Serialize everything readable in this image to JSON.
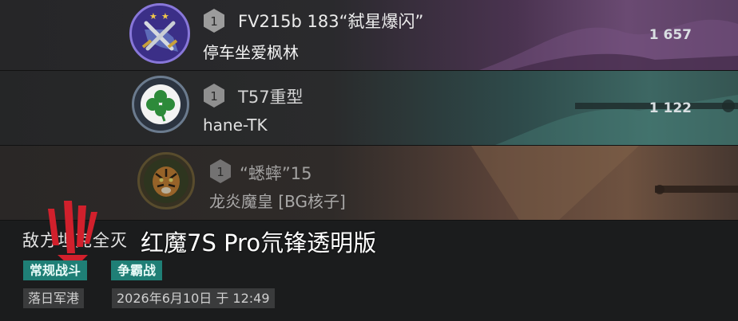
{
  "rows": [
    {
      "rank": "1",
      "vehicle": "FV215b 183“弑星爆闪”",
      "player": "停车坐爱枫林",
      "score": "1 657",
      "emblem": "crossed-swords-two-stars-icon"
    },
    {
      "rank": "1",
      "vehicle": "T57重型",
      "player": "hane-TK",
      "score": "1 122",
      "emblem": "clover-icon"
    },
    {
      "rank": "1",
      "vehicle": "“蟋蟀”15",
      "player": "龙炎魔皇 [BG核子]",
      "score": "",
      "emblem": "tiger-icon"
    }
  ],
  "header": {
    "title": "敌方坦克全灭",
    "watermark": "红魔7S Pro氘锋透明版"
  },
  "tags": [
    "常规战斗",
    "争霸战"
  ],
  "meta": {
    "map": "落日军港",
    "datetime": "2026年6月10日 于 12:49"
  },
  "colors": {
    "tag_bg": "#1f7f76",
    "brand_red": "#d1202c"
  }
}
